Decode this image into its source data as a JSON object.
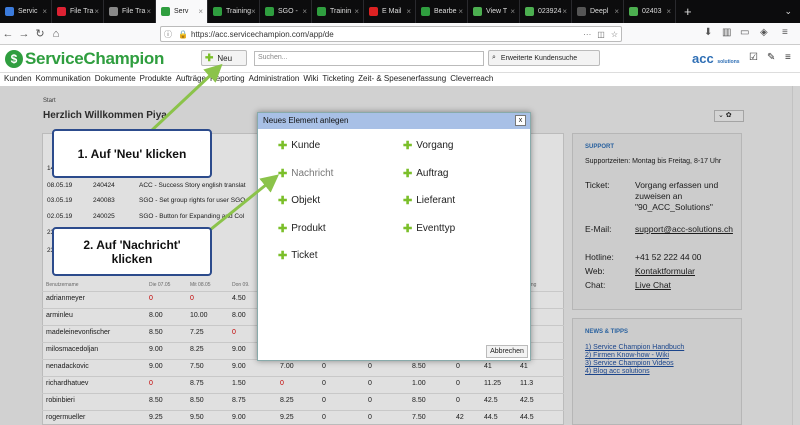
{
  "browser": {
    "tabs": [
      {
        "label": "Servic",
        "color": "#3b7bdc",
        "active": false
      },
      {
        "label": "File Tra",
        "color": "#d23",
        "active": false
      },
      {
        "label": "File Tra",
        "color": "#888",
        "active": false
      },
      {
        "label": "Serv",
        "color": "#2f9e3f",
        "active": true
      },
      {
        "label": "Training",
        "color": "#2f9e3f",
        "active": false
      },
      {
        "label": "SGO -",
        "color": "#2f9e3f",
        "active": false
      },
      {
        "label": "Trainin",
        "color": "#2f9e3f",
        "active": false
      },
      {
        "label": "E Mail",
        "color": "#d22",
        "active": false
      },
      {
        "label": "Bearbe",
        "color": "#2f9e3f",
        "active": false
      },
      {
        "label": "View T",
        "color": "#4caf50",
        "active": false
      },
      {
        "label": "023924",
        "color": "#4caf50",
        "active": false
      },
      {
        "label": "Deepl",
        "color": "#555",
        "active": false
      },
      {
        "label": "02403",
        "color": "#4caf50",
        "active": false
      }
    ],
    "new_tab": "+",
    "url": "https://acc.servicechampion.com/app/de",
    "search_placeholder": ""
  },
  "app": {
    "logo_text": "ServiceChampion",
    "new_button": "Neu",
    "search_placeholder": "Suchen...",
    "extended_search": "Erweiterte Kundensuche",
    "partner_logo": "acc",
    "partner_sub": "solutions",
    "notification_count": "1"
  },
  "menu": [
    "Kunden",
    "Kommunikation",
    "Dokumente",
    "Produkte",
    "Aufträge",
    "Reporting",
    "Administration",
    "Wiki",
    "Ticketing",
    "Zeit- & Spesenerfassung",
    "Cleverreach"
  ],
  "page": {
    "breadcrumb": "Start",
    "welcome": "Herzlich Willkommen Piya"
  },
  "panel_rows": [
    {
      "date": "14.",
      "num": "",
      "text": "user anlegen"
    },
    {
      "date": "08.05.19",
      "num": "240424",
      "text": "ACC - Success Story english translat"
    },
    {
      "date": "03.05.19",
      "num": "240083",
      "text": "SGO - Set group rights for user SGO"
    },
    {
      "date": "02.05.19",
      "num": "240025",
      "text": "SGO - Button for Expanding and Col"
    },
    {
      "date": "23.",
      "num": "",
      "text": "ceben - public wi"
    },
    {
      "date": "23.",
      "num": "",
      "text": "ge mit den K"
    }
  ],
  "table": {
    "headers": [
      "Benutzername",
      "Die 07.05",
      "Mit 08.05",
      "Don 09.",
      "",
      "",
      "",
      "",
      "",
      "",
      "echung"
    ],
    "rows": [
      {
        "name": "adrianmeyer",
        "cells": [
          "0",
          "0",
          "4.50",
          "",
          "",
          "",
          "",
          "",
          ""
        ]
      },
      {
        "name": "arminleu",
        "cells": [
          "8.00",
          "10.00",
          "8.00",
          "",
          "",
          "",
          "",
          "",
          ""
        ]
      },
      {
        "name": "madeleinevonfischer",
        "cells": [
          "8.50",
          "7.25",
          "0",
          "",
          "",
          "",
          "",
          "",
          ""
        ]
      },
      {
        "name": "milosmacedoljan",
        "cells": [
          "9.00",
          "8.25",
          "9.00",
          "",
          "",
          "",
          "",
          "",
          ""
        ]
      },
      {
        "name": "nenadackovic",
        "cells": [
          "9.00",
          "7.50",
          "9.00",
          "7.00",
          "0",
          "0",
          "8.50",
          "0",
          "41",
          "41"
        ]
      },
      {
        "name": "richardhatuev",
        "cells": [
          "0",
          "8.75",
          "1.50",
          "0",
          "0",
          "0",
          "1.00",
          "0",
          "11.25",
          "11.3"
        ]
      },
      {
        "name": "robinbieri",
        "cells": [
          "8.50",
          "8.50",
          "8.75",
          "8.25",
          "0",
          "0",
          "8.50",
          "0",
          "42.5",
          "42.5"
        ]
      },
      {
        "name": "rogermueller",
        "cells": [
          "9.25",
          "9.50",
          "9.00",
          "9.25",
          "0",
          "0",
          "7.50",
          "42",
          "44.5",
          "44.5"
        ]
      }
    ]
  },
  "support": {
    "title": "SUPPORT",
    "hours": "Supportzeiten: Montag bis Freitag, 8-17 Uhr",
    "ticket_label": "Ticket:",
    "ticket_value": "Vorgang erfassen und zuweisen an \"90_ACC_Solutions\"",
    "email_label": "E-Mail:",
    "email_value": "support@acc-solutions.ch",
    "hotline_label": "Hotline:",
    "hotline_value": "+41 52 222 44 00",
    "web_label": "Web:",
    "web_value": "Kontaktformular",
    "chat_label": "Chat:",
    "chat_value": "Live Chat"
  },
  "news": {
    "title": "NEWS & TIPPS",
    "items": [
      "1) Service Champion Handbuch",
      "2) Firmen Know-how - Wiki",
      "3) Service Champion Videos",
      "4) Blog acc solutions"
    ]
  },
  "dialog": {
    "title": "Neues Element anlegen",
    "close": "x",
    "left_items": [
      "Kunde",
      "Nachricht",
      "Objekt",
      "Produkt",
      "Ticket"
    ],
    "right_items": [
      "Vorgang",
      "Auftrag",
      "Lieferant",
      "Eventtyp"
    ],
    "cancel": "Abbrechen"
  },
  "callouts": {
    "step1": "1. Auf 'Neu' klicken",
    "step2": "2. Auf 'Nachricht' klicken"
  },
  "colors": {
    "brand_green": "#2f9e3f",
    "accent_blue": "#2f6fb5",
    "arrow_green": "#8bc34a"
  }
}
